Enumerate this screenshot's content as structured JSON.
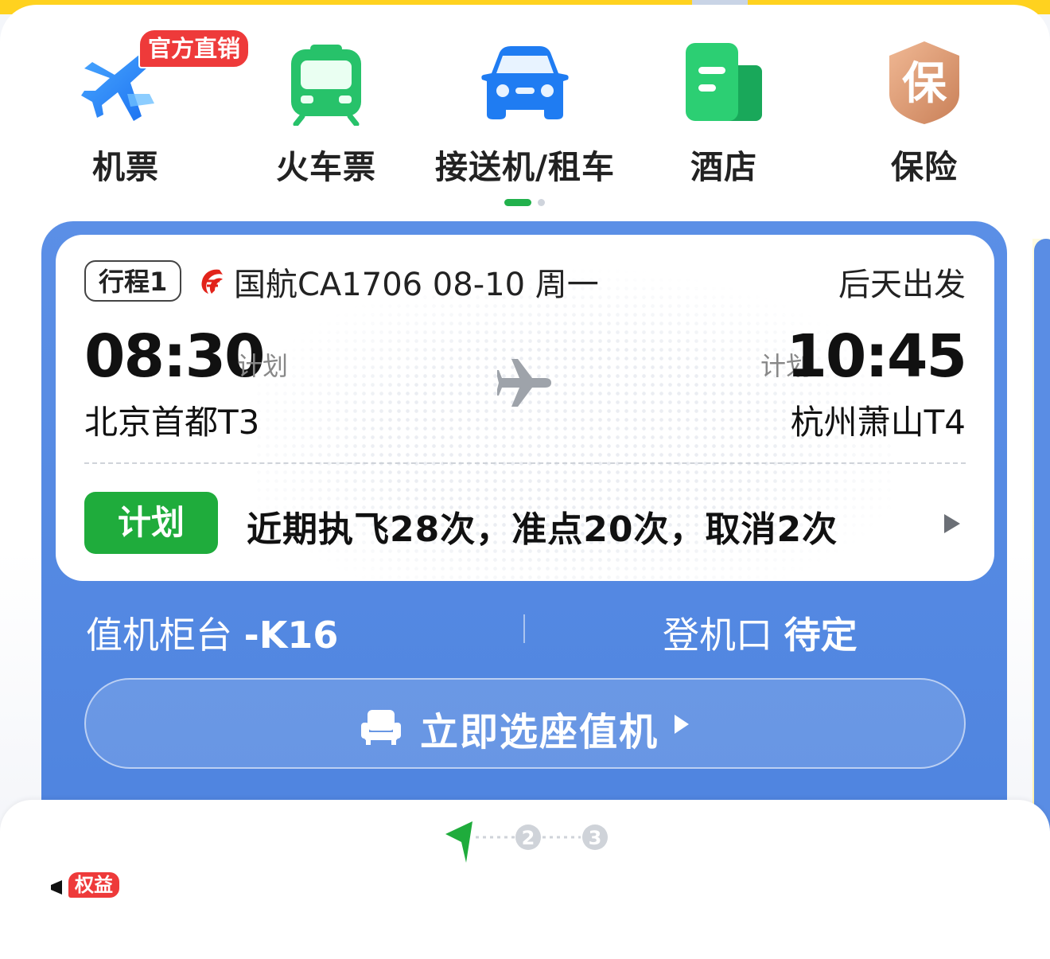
{
  "nav": {
    "items": [
      {
        "label": "机票",
        "badge": "官方直销",
        "icon": "plane-icon"
      },
      {
        "label": "火车票",
        "icon": "train-icon"
      },
      {
        "label": "接送机/租车",
        "icon": "car-icon"
      },
      {
        "label": "酒店",
        "icon": "hotel-icon"
      },
      {
        "label": "保险",
        "icon": "insurance-icon",
        "icon_text": "保"
      }
    ],
    "page_count": 2,
    "active_page": 1
  },
  "trip": {
    "tag": "行程1",
    "flight_info": "国航CA1706 08-10 周一",
    "depart_when": "后天出发",
    "departure": {
      "time": "08:30",
      "plan_label": "计划",
      "airport": "北京首都T3"
    },
    "arrival": {
      "time": "10:45",
      "plan_label": "计划",
      "airport": "杭州萧山T4"
    },
    "status_badge": "计划",
    "stats": "近期执飞28次，准点20次，取消2次",
    "counter_label": "值机柜台",
    "counter_value": "-K16",
    "gate_label": "登机口",
    "gate_value": "待定",
    "checkin_button": "立即选座值机"
  },
  "bottom": {
    "rights_badge": "权益",
    "steps": [
      "2",
      "3"
    ]
  },
  "colors": {
    "accent_green": "#1fac3c",
    "card_blue": "#5b8fe6",
    "badge_red": "#ee3a3a",
    "brand_yellow": "#ffd21f"
  }
}
